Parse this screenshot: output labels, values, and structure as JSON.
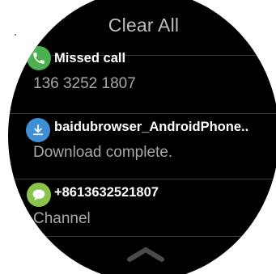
{
  "header": {
    "clear_all_label": "Clear All"
  },
  "notifications": [
    {
      "icon": "phone-icon",
      "icon_color": "#4caf50",
      "title": "Missed call",
      "body": "136 3252 1807"
    },
    {
      "icon": "download-icon",
      "icon_color": "#3f8fd6",
      "title": "baidubrowser_AndroidPhone..",
      "body": "Download complete."
    },
    {
      "icon": "message-icon",
      "icon_color": "#8bc34a",
      "title": "+8613632521807",
      "body": "Channel"
    }
  ],
  "footer": {
    "icon": "chevron-up-icon"
  },
  "colors": {
    "watch_bg": "#000000",
    "title_text": "#ffffff",
    "body_text": "#a8a8a8",
    "header_text": "#bdbdbd"
  }
}
